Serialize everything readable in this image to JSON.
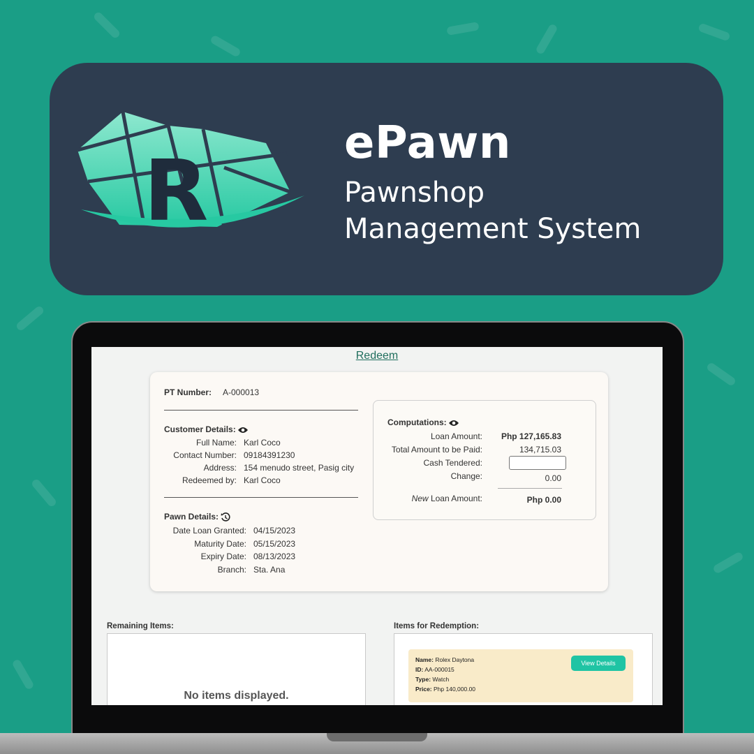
{
  "brand": {
    "title": "ePawn",
    "subtitle_line1": "Pawnshop",
    "subtitle_line2": "Management System",
    "logo_letter": "R"
  },
  "colors": {
    "background": "#1a9e86",
    "banner": "#2e3d50",
    "accent": "#1fc4a4",
    "title_link": "#1f6e5d"
  },
  "screen": {
    "page_title": "Redeem",
    "pt_number_label": "PT Number:",
    "pt_number_value": "A-000013",
    "customer": {
      "heading": "Customer Details:",
      "icon": "eye-icon",
      "rows": [
        {
          "label": "Full Name:",
          "value": "Karl Coco"
        },
        {
          "label": "Contact Number:",
          "value": "09184391230"
        },
        {
          "label": "Address:",
          "value": "154 menudo street, Pasig city"
        },
        {
          "label": "Redeemed by:",
          "value": "Karl Coco"
        }
      ]
    },
    "pawn": {
      "heading": "Pawn Details:",
      "icon": "history-icon",
      "rows": [
        {
          "label": "Date Loan Granted:",
          "value": "04/15/2023"
        },
        {
          "label": "Maturity Date:",
          "value": "05/15/2023"
        },
        {
          "label": "Expiry Date:",
          "value": "08/13/2023"
        },
        {
          "label": "Branch:",
          "value": "Sta. Ana"
        }
      ]
    },
    "computations": {
      "heading": "Computations:",
      "icon": "eye-icon",
      "loan_amount_label": "Loan Amount:",
      "loan_amount_value": "Php 127,165.83",
      "total_label": "Total Amount to be Paid:",
      "total_value": "134,715.03",
      "cash_label": "Cash Tendered:",
      "cash_value": "",
      "change_label": "Change:",
      "change_value": "0.00",
      "new_loan_prefix": "New",
      "new_loan_label": " Loan Amount:",
      "new_loan_value": "Php 0.00"
    },
    "remaining": {
      "heading": "Remaining Items:",
      "empty_text": "No items displayed."
    },
    "redemption": {
      "heading": "Items for Redemption:",
      "item": {
        "name_label": "Name:",
        "name": "Rolex Daytona",
        "id_label": "ID:",
        "id": "AA-000015",
        "type_label": "Type:",
        "type": "Watch",
        "price_label": "Price:",
        "price": "Php 140,000.00",
        "button": "View Details"
      }
    }
  }
}
